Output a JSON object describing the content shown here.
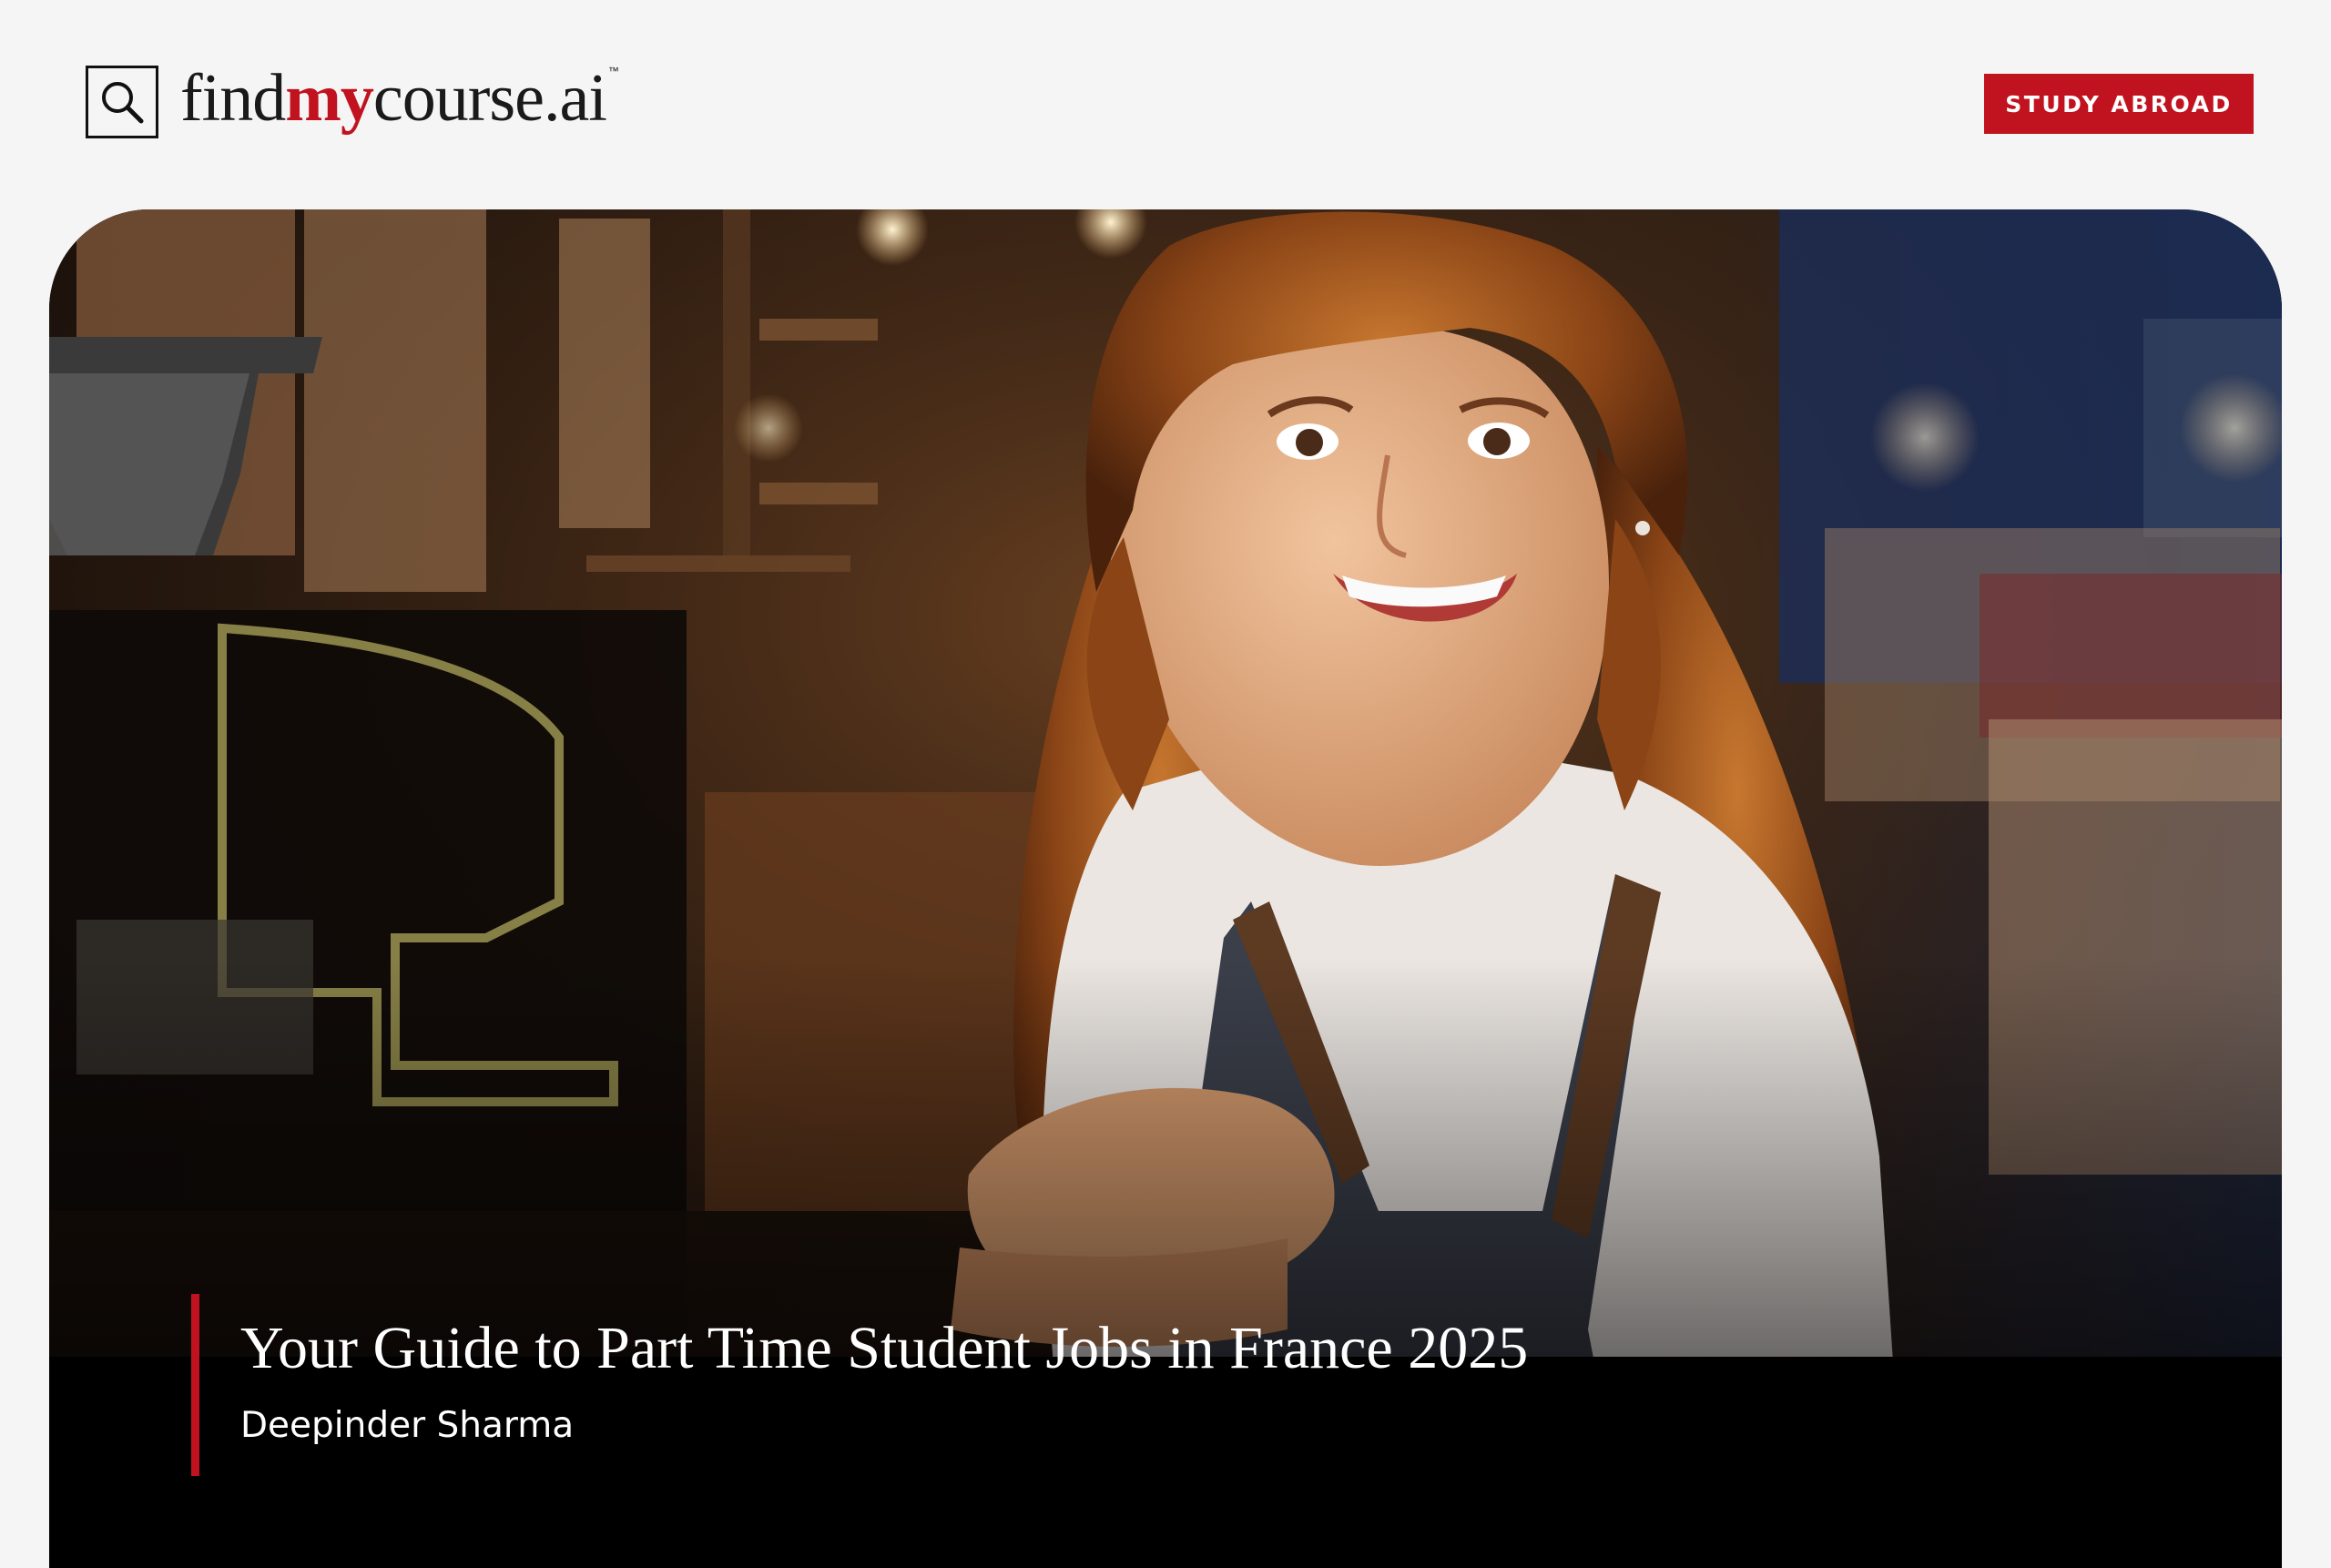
{
  "header": {
    "logo": {
      "text_before": "find",
      "text_accent": "my",
      "text_after": "course.ai",
      "trademark": "™"
    },
    "cta_label": "STUDY ABROAD"
  },
  "hero": {
    "title": "Your Guide to Part Time Student Jobs in France 2025",
    "author": "Deepinder Sharma"
  },
  "colors": {
    "brand_red": "#c1121f",
    "page_background": "#f5f5f5",
    "caption_background": "#000000"
  },
  "icons": {
    "logo_icon": "search-icon"
  }
}
